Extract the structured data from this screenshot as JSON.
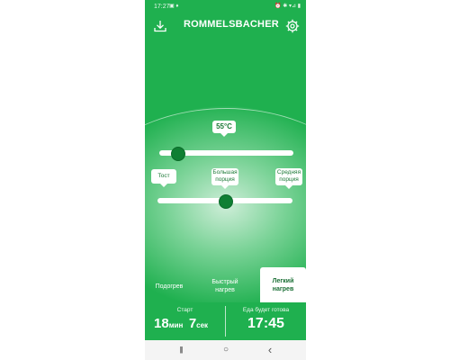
{
  "status": {
    "time": "17:27",
    "left_icons": "▣ ♦",
    "right_icons": "⏰ ✱ ▾⊿ ▮"
  },
  "app": {
    "logo_text": "ROMMELSBACHER"
  },
  "temperature": {
    "value_label": "55°C",
    "level_fraction": 0.1
  },
  "portion": {
    "labels": [
      "Тост",
      "Большая\nпорция",
      "Средняя\nпорция"
    ],
    "selected_index": 1
  },
  "tabs": [
    {
      "label": "Подогрев",
      "active": false
    },
    {
      "label": "Быстрый\nнагрев",
      "active": false
    },
    {
      "label": "Легкий\nнагрев",
      "active": true
    }
  ],
  "start": {
    "label": "Старт",
    "minutes": "18",
    "min_unit": "мин",
    "seconds": "7",
    "sec_unit": "сек"
  },
  "ready": {
    "label": "Еда будет готова",
    "time": "17:45"
  },
  "nav": {
    "recents": "|||",
    "home": "○",
    "back": "‹"
  },
  "colors": {
    "brand_green": "#1fb04f",
    "thumb_green": "#0f7f33"
  }
}
